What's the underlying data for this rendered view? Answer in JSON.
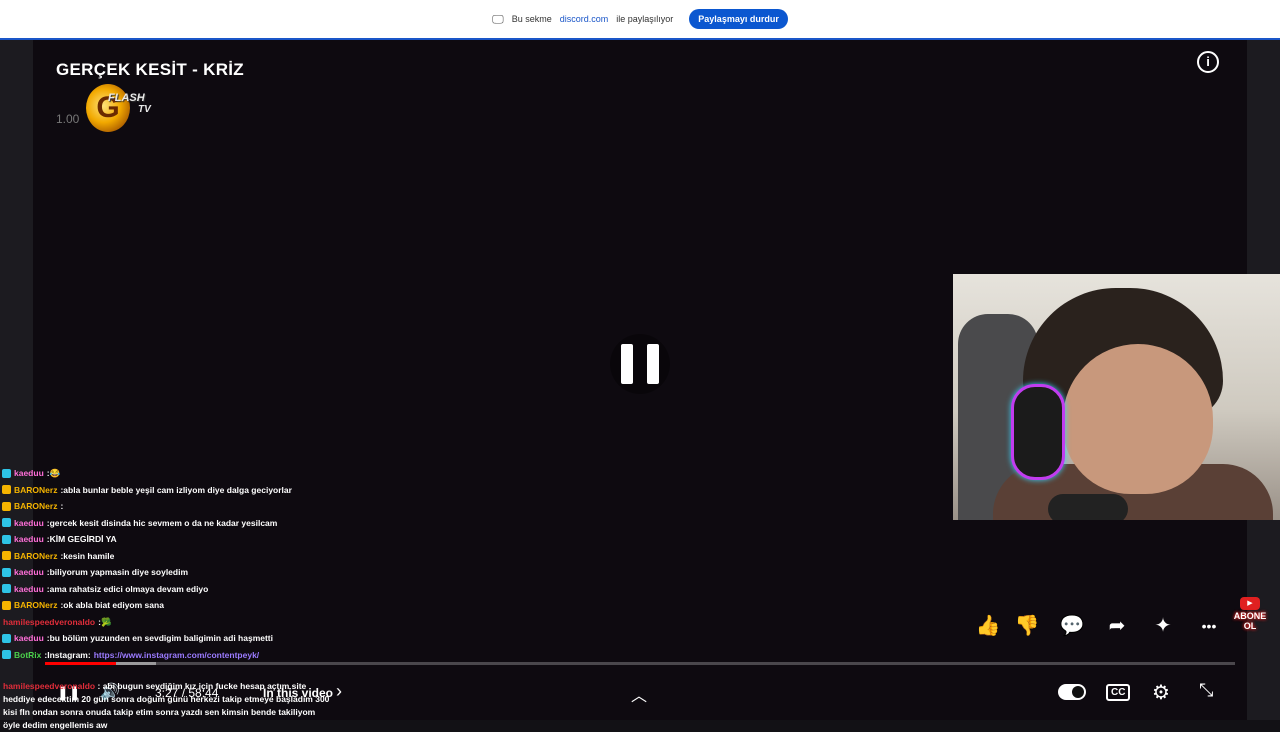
{
  "share_bar": {
    "prefix": "Bu sekme",
    "domain": "discord.com",
    "suffix": "ile paylaşılıyor",
    "stop_button": "Paylaşmayı durdur"
  },
  "video": {
    "title": "GERÇEK KESİT - KRİZ",
    "speed_label": "1.00",
    "logo_letter": "G",
    "logo_flash": "FLASH",
    "logo_tv": "TV",
    "info_icon": "i",
    "paused": false
  },
  "subscribe": {
    "yt_icon": "▶",
    "line1": "ABONE",
    "line2": "OL"
  },
  "actions": {
    "like": "👍",
    "dislike": "👎",
    "comments": "💬",
    "share": "➦",
    "sparkle": "✦",
    "more": "•••"
  },
  "progress": {
    "played_fraction": 0.06,
    "buffered_fraction": 0.093
  },
  "controls": {
    "time": "3:27 / 58:44",
    "in_this_video": "In this video",
    "chevron": "›",
    "up": "︿",
    "cc": "CC",
    "settings": "⚙",
    "fullscreen_exit": "⤡"
  },
  "colors": {
    "twitch_badge": "#2ec4e6",
    "gold_badge": "#f5b400",
    "kaeduu": "#e07fff",
    "baronerz": "#f5b400",
    "hamile": "#e02d3a",
    "botrix": "#4bd14b"
  },
  "chat": [
    {
      "user": "kaeduu",
      "msg": "😂",
      "color": "#ff6fd8",
      "badge": "#2ec4e6"
    },
    {
      "user": "BARONerz",
      "msg": "abla bunlar beble yeşil cam izliyom diye dalga geciyorlar",
      "color": "#f5b400",
      "badge": "#f5b400"
    },
    {
      "user": "BARONerz",
      "msg": "",
      "color": "#f5b400",
      "badge": "#f5b400"
    },
    {
      "user": "kaeduu",
      "msg": "gercek kesit disinda hic sevmem o da ne kadar yesilcam",
      "color": "#ff6fd8",
      "badge": "#2ec4e6"
    },
    {
      "user": "kaeduu",
      "msg": "KİM GEGİRDİ YA",
      "color": "#ff6fd8",
      "badge": "#2ec4e6"
    },
    {
      "user": "BARONerz",
      "msg": "kesin hamile",
      "color": "#f5b400",
      "badge": "#f5b400"
    },
    {
      "user": "kaeduu",
      "msg": "biliyorum yapmasin diye soyledim",
      "color": "#ff6fd8",
      "badge": "#2ec4e6"
    },
    {
      "user": "kaeduu",
      "msg": "ama rahatsiz edici olmaya devam ediyo",
      "color": "#ff6fd8",
      "badge": "#2ec4e6"
    },
    {
      "user": "BARONerz",
      "msg": "ok abla biat ediyom sana",
      "color": "#f5b400",
      "badge": "#f5b400"
    },
    {
      "user": "hamilespeedveronaldo",
      "msg": "🥦",
      "color": "#e02d3a",
      "badge": ""
    },
    {
      "user": "kaeduu",
      "msg": "bu bölüm yuzunden en sevdigim baligimin adi haşmetti",
      "color": "#ff6fd8",
      "badge": "#2ec4e6"
    },
    {
      "user": "BotRix",
      "msg": "Instagram:",
      "url": "https://www.instagram.com/contentpeyk/",
      "color": "#4bd14b",
      "badge": "#2ec4e6"
    }
  ],
  "chat_last": {
    "user": "hamilespeedveronaldo",
    "msg": "abi bugun sevdiğim kız için fucke hesap açtım site heddiye edecektim 20 gün sonra doğum günü herkezi takip etmeye başladım 300 kisi fln ondan sonra onuda takip etim sonra yazdı sen kimsin bende takiliyom öyle dedim engellemis aw"
  }
}
